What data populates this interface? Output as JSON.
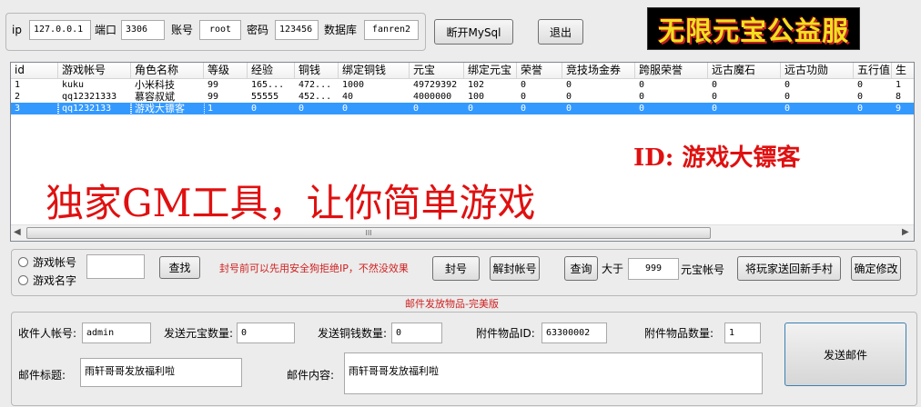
{
  "connection": {
    "ip_label": "ip",
    "ip_value": "127.0.0.1",
    "port_label": "端口",
    "port_value": "3306",
    "account_label": "账号",
    "account_value": "root",
    "password_label": "密码",
    "password_value": "123456",
    "db_label": "数据库",
    "db_value": "fanren2",
    "disconnect_button": "断开MySql",
    "exit_button": "退出"
  },
  "banner": {
    "text": "无限元宝公益服"
  },
  "overlay": {
    "id_text": "ID: 游戏大镖客",
    "slogan": "独家GM工具，让你简单游戏"
  },
  "table": {
    "columns": [
      "id",
      "游戏帐号",
      "角色名称",
      "等级",
      "经验",
      "铜钱",
      "绑定铜钱",
      "元宝",
      "绑定元宝",
      "荣誉",
      "竞技场金券",
      "跨服荣誉",
      "远古魔石",
      "远古功勋",
      "五行值",
      "生"
    ],
    "rows": [
      [
        "1",
        "kuku",
        "小米科技",
        "99",
        "165...",
        "472...",
        "1000",
        "49729392",
        "102",
        "0",
        "0",
        "0",
        "0",
        "0",
        "0",
        "1"
      ],
      [
        "2",
        "qq12321333",
        "慕容叔斌",
        "99",
        "55555",
        "452...",
        "40",
        "4000000",
        "100",
        "0",
        "0",
        "0",
        "0",
        "0",
        "0",
        "8"
      ],
      [
        "3",
        "qq1232133",
        "游戏大镖客",
        "1",
        "0",
        "0",
        "0",
        "0",
        "0",
        "0",
        "0",
        "0",
        "0",
        "0",
        "0",
        "9"
      ]
    ],
    "selected_row": 2,
    "scroll_grip": "III"
  },
  "search": {
    "radio_account": "游戏帐号",
    "radio_name": "游戏名字",
    "input_value": "",
    "find_button": "查找",
    "warning": "封号前可以先用安全狗拒绝IP，不然没效果",
    "ban_button": "封号",
    "unban_button": "解封帐号",
    "query_button": "查询",
    "greater_label": "大于",
    "greater_value": "999",
    "ingot_account_label": "元宝帐号",
    "send_newbie_button": "将玩家送回新手村",
    "confirm_button": "确定修改"
  },
  "mail": {
    "section_title": "邮件发放物品-完美版",
    "recipient_label": "收件人帐号:",
    "recipient_value": "admin",
    "ingot_label": "发送元宝数量:",
    "ingot_value": "0",
    "copper_label": "发送铜钱数量:",
    "copper_value": "0",
    "item_id_label": "附件物品ID:",
    "item_id_value": "63300002",
    "item_qty_label": "附件物品数量:",
    "item_qty_value": "1",
    "title_label": "邮件标题:",
    "title_value": "雨轩哥哥发放福利啦",
    "content_label": "邮件内容:",
    "content_value": "雨轩哥哥发放福利啦",
    "send_button": "发送邮件"
  },
  "colors": {
    "accent_red": "#e01010",
    "selection": "#3399ff",
    "banner_bg": "#000000",
    "banner_text": "#f0e020",
    "warning_text": "#d02020"
  },
  "icons": {
    "scroll_left": "chevron-left-icon",
    "scroll_right": "chevron-right-icon"
  }
}
